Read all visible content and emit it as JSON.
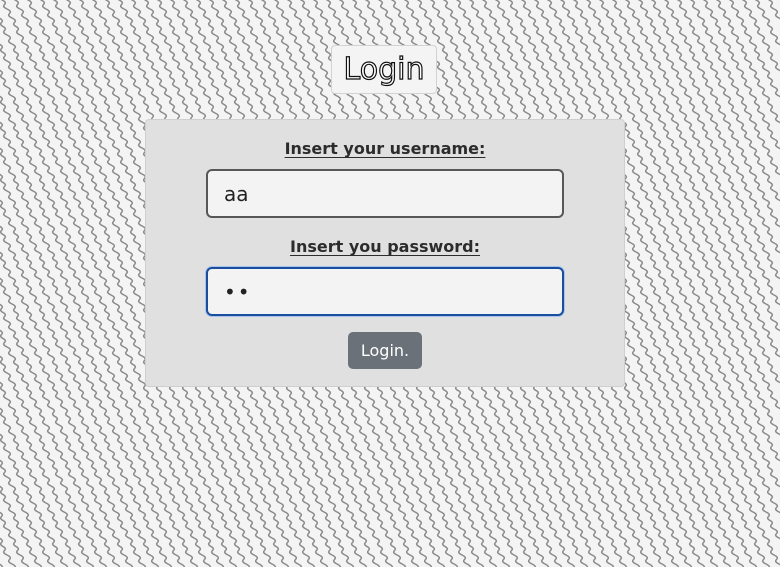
{
  "page": {
    "title": "Login"
  },
  "form": {
    "username_label": "Insert your username:",
    "username_value": "aa",
    "password_label": "Insert you password:",
    "password_value": "aa",
    "submit_label": "Login."
  },
  "colors": {
    "background": "#f4f4f4",
    "pattern": "#8a8a8a",
    "card_background": "#e0e0e0",
    "focus_border": "#1a4fa0",
    "button": "#6a7178"
  }
}
